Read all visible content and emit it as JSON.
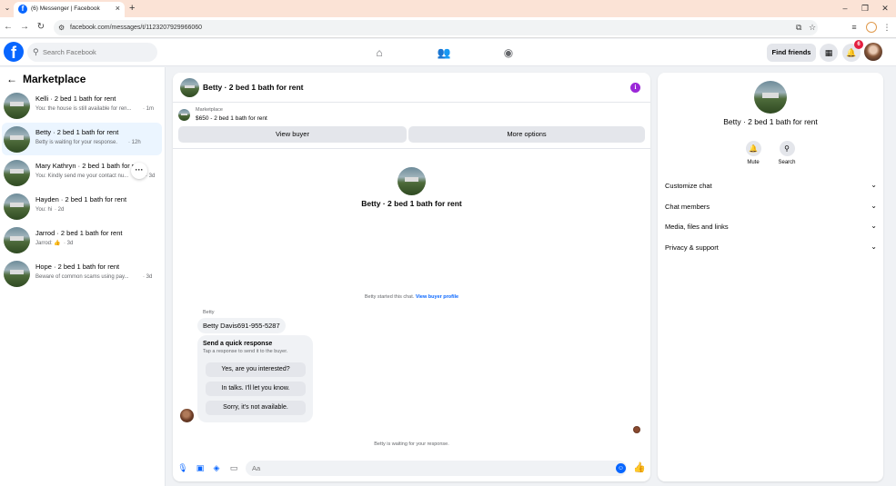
{
  "browser": {
    "tab_title": "(6) Messenger | Facebook",
    "tab_close": "×",
    "new_tab": "+",
    "url": "facebook.com/messages/t/1123207929966060"
  },
  "fb": {
    "logo": "f",
    "search_placeholder": "Search Facebook",
    "find_friends": "Find friends",
    "notification_count": "6"
  },
  "sidebar": {
    "title": "Marketplace",
    "conversations": [
      {
        "name": "Kelli · 2 bed 1 bath for rent",
        "preview": "You: the house is still available for ren...",
        "time": "· 1m"
      },
      {
        "name": "Betty · 2 bed 1 bath for rent",
        "preview": "Betty is waiting for your response.",
        "time": "· 12h"
      },
      {
        "name": "Mary Kathryn · 2 bed 1 bath for rent",
        "preview": "You: Kindly send me your contact nu...",
        "time": "· 3d"
      },
      {
        "name": "Hayden · 2 bed 1 bath for rent",
        "preview": "You: hi",
        "time": "· 2d"
      },
      {
        "name": "Jarrod · 2 bed 1 bath for rent",
        "preview": "Jarrod: 👍",
        "time": "· 3d"
      },
      {
        "name": "Hope · 2 bed 1 bath for rent",
        "preview": "Beware of common scams using pay...",
        "time": "· 3d"
      }
    ],
    "more_options_glyph": "···"
  },
  "chat": {
    "header_name": "Betty · 2 bed 1 bath for rent",
    "info_glyph": "i",
    "marketplace_label": "Marketplace",
    "listing": "$650 - 2 bed 1 bath for rent",
    "view_buyer": "View buyer",
    "more_options": "More options",
    "center_name": "Betty · 2 bed 1 bath for rent",
    "system_text": "Betty started this chat.",
    "system_link": "View buyer profile",
    "sender": "Betty",
    "message": "Betty Davis691-955-5287",
    "quick_title": "Send a quick response",
    "quick_sub": "Tap a response to send it to the buyer.",
    "quick_options": [
      "Yes, are you interested?",
      "In talks. I'll let you know.",
      "Sorry, it's not available."
    ],
    "waiting": "Betty is waiting for your response.",
    "composer_placeholder": "Aa"
  },
  "info": {
    "name": "Betty · 2 bed 1 bath for rent",
    "mute": "Mute",
    "search": "Search",
    "sections": [
      "Customize chat",
      "Chat members",
      "Media, files and links",
      "Privacy & support"
    ]
  },
  "colors": {
    "brand": "#0866ff",
    "active_row": "#ebf5ff",
    "info_purple": "#9b27d8",
    "badge_red": "#e41e3f"
  }
}
